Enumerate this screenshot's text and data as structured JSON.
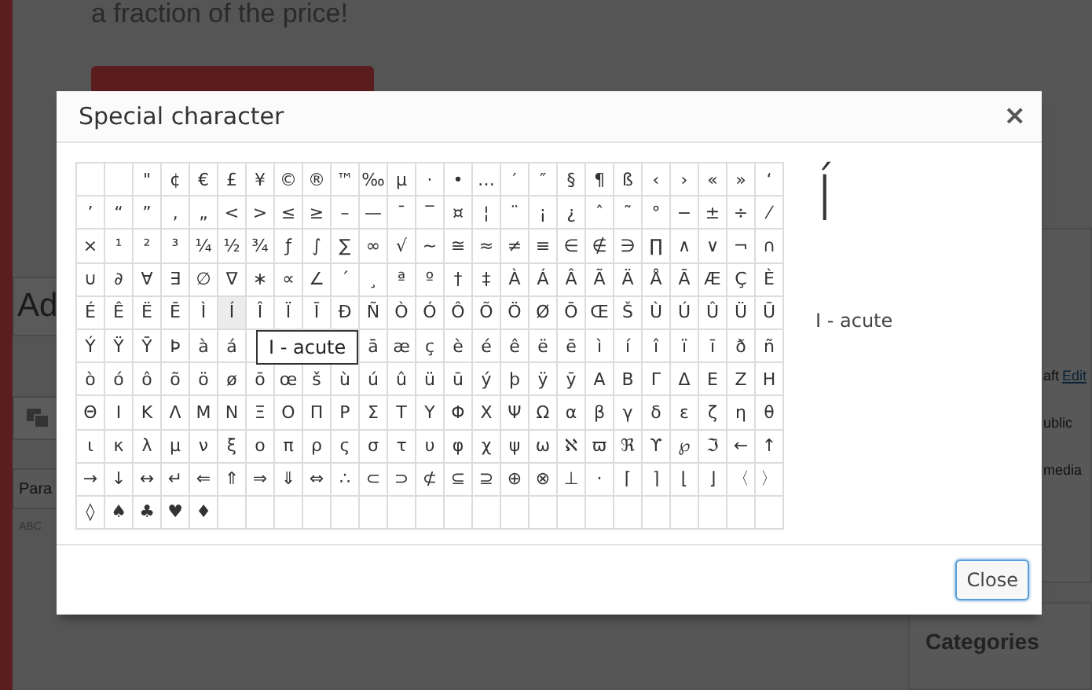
{
  "page": {
    "promo_text": "a fraction of the price!",
    "title_field": "Ad",
    "format_select": "Para",
    "spellcheck_label": "ABC",
    "sidebar": {
      "status_text": "aft",
      "status_link": "Edit",
      "visibility_text": "ublic",
      "media_text": "media",
      "categories_title": "Categories"
    }
  },
  "dialog": {
    "title": "Special character",
    "close_symbol": "×",
    "rows": [
      [
        {
          "hovered": false
        },
        {
          "hovered": false
        },
        {
          "c": "\"",
          "hovered": false
        },
        {
          "c": "¢",
          "hovered": false
        },
        {
          "c": "€",
          "hovered": false
        },
        {
          "c": "£",
          "hovered": false
        },
        {
          "c": "¥",
          "hovered": false
        },
        {
          "c": "©",
          "hovered": false
        },
        {
          "c": "®",
          "hovered": false
        },
        {
          "c": "™",
          "hovered": false
        },
        {
          "c": "‰",
          "hovered": false
        },
        {
          "c": "µ",
          "hovered": false
        },
        {
          "c": "·",
          "hovered": false
        },
        {
          "c": "•",
          "hovered": false
        },
        {
          "c": "…",
          "hovered": false
        },
        {
          "c": "′",
          "hovered": false
        },
        {
          "c": "″",
          "hovered": false
        },
        {
          "c": "§",
          "hovered": false
        },
        {
          "c": "¶",
          "hovered": false
        },
        {
          "c": "ß",
          "hovered": false
        },
        {
          "c": "‹",
          "hovered": false
        },
        {
          "c": "›",
          "hovered": false
        },
        {
          "c": "«",
          "hovered": false
        },
        {
          "c": "»",
          "hovered": false
        },
        {
          "c": "‘",
          "hovered": false
        }
      ],
      [
        {
          "c": "’",
          "hovered": false
        },
        {
          "c": "“",
          "hovered": false
        },
        {
          "c": "”",
          "hovered": false
        },
        {
          "c": "‚",
          "hovered": false
        },
        {
          "c": "„",
          "hovered": false
        },
        {
          "c": "<",
          "hovered": false
        },
        {
          "c": ">",
          "hovered": false
        },
        {
          "c": "≤",
          "hovered": false
        },
        {
          "c": "≥",
          "hovered": false
        },
        {
          "c": "–",
          "hovered": false
        },
        {
          "c": "—",
          "hovered": false
        },
        {
          "c": "¯",
          "hovered": false
        },
        {
          "c": "‾",
          "hovered": false
        },
        {
          "c": "¤",
          "hovered": false
        },
        {
          "c": "¦",
          "hovered": false
        },
        {
          "c": "¨",
          "hovered": false
        },
        {
          "c": "¡",
          "hovered": false
        },
        {
          "c": "¿",
          "hovered": false
        },
        {
          "c": "ˆ",
          "hovered": false
        },
        {
          "c": "˜",
          "hovered": false
        },
        {
          "c": "°",
          "hovered": false
        },
        {
          "c": "−",
          "hovered": false
        },
        {
          "c": "±",
          "hovered": false
        },
        {
          "c": "÷",
          "hovered": false
        },
        {
          "c": "⁄",
          "hovered": false
        }
      ],
      [
        {
          "c": "×",
          "hovered": false
        },
        {
          "c": "¹",
          "hovered": false
        },
        {
          "c": "²",
          "hovered": false
        },
        {
          "c": "³",
          "hovered": false
        },
        {
          "c": "¼",
          "hovered": false
        },
        {
          "c": "½",
          "hovered": false
        },
        {
          "c": "¾",
          "hovered": false
        },
        {
          "c": "ƒ",
          "hovered": false
        },
        {
          "c": "∫",
          "hovered": false
        },
        {
          "c": "∑",
          "hovered": false
        },
        {
          "c": "∞",
          "hovered": false
        },
        {
          "c": "√",
          "hovered": false
        },
        {
          "c": "∼",
          "hovered": false
        },
        {
          "c": "≅",
          "hovered": false
        },
        {
          "c": "≈",
          "hovered": false
        },
        {
          "c": "≠",
          "hovered": false
        },
        {
          "c": "≡",
          "hovered": false
        },
        {
          "c": "∈",
          "hovered": false
        },
        {
          "c": "∉",
          "hovered": false
        },
        {
          "c": "∋",
          "hovered": false
        },
        {
          "c": "∏",
          "hovered": false
        },
        {
          "c": "∧",
          "hovered": false
        },
        {
          "c": "∨",
          "hovered": false
        },
        {
          "c": "¬",
          "hovered": false
        },
        {
          "c": "∩",
          "hovered": false
        }
      ],
      [
        {
          "c": "∪",
          "hovered": false
        },
        {
          "c": "∂",
          "hovered": false
        },
        {
          "c": "∀",
          "hovered": false
        },
        {
          "c": "∃",
          "hovered": false
        },
        {
          "c": "∅",
          "hovered": false
        },
        {
          "c": "∇",
          "hovered": false
        },
        {
          "c": "∗",
          "hovered": false
        },
        {
          "c": "∝",
          "hovered": false
        },
        {
          "c": "∠",
          "hovered": false
        },
        {
          "c": "´",
          "hovered": false
        },
        {
          "c": "¸",
          "hovered": false
        },
        {
          "c": "ª",
          "hovered": false
        },
        {
          "c": "º",
          "hovered": false
        },
        {
          "c": "†",
          "hovered": false
        },
        {
          "c": "‡",
          "hovered": false
        },
        {
          "c": "À",
          "hovered": false
        },
        {
          "c": "Á",
          "hovered": false
        },
        {
          "c": "Â",
          "hovered": false
        },
        {
          "c": "Ã",
          "hovered": false
        },
        {
          "c": "Ä",
          "hovered": false
        },
        {
          "c": "Å",
          "hovered": false
        },
        {
          "c": "Ā",
          "hovered": false
        },
        {
          "c": "Æ",
          "hovered": false
        },
        {
          "c": "Ç",
          "hovered": false
        },
        {
          "c": "È",
          "hovered": false
        }
      ],
      [
        {
          "c": "É",
          "hovered": false
        },
        {
          "c": "Ê",
          "hovered": false
        },
        {
          "c": "Ë",
          "hovered": false
        },
        {
          "c": "Ē",
          "hovered": false
        },
        {
          "c": "Ì",
          "hovered": false
        },
        {
          "c": "Í",
          "hovered": true
        },
        {
          "c": "Î",
          "hovered": false
        },
        {
          "c": "Ï",
          "hovered": false
        },
        {
          "c": "Ī",
          "hovered": false
        },
        {
          "c": "Ð",
          "hovered": false
        },
        {
          "c": "Ñ",
          "hovered": false
        },
        {
          "c": "Ò",
          "hovered": false
        },
        {
          "c": "Ó",
          "hovered": false
        },
        {
          "c": "Ô",
          "hovered": false
        },
        {
          "c": "Õ",
          "hovered": false
        },
        {
          "c": "Ö",
          "hovered": false
        },
        {
          "c": "Ø",
          "hovered": false
        },
        {
          "c": "Ō",
          "hovered": false
        },
        {
          "c": "Œ",
          "hovered": false
        },
        {
          "c": "Š",
          "hovered": false
        },
        {
          "c": "Ù",
          "hovered": false
        },
        {
          "c": "Ú",
          "hovered": false
        },
        {
          "c": "Û",
          "hovered": false
        },
        {
          "c": "Ü",
          "hovered": false
        },
        {
          "c": "Ū",
          "hovered": false
        }
      ],
      [
        {
          "c": "Ý",
          "hovered": false
        },
        {
          "c": "Ÿ",
          "hovered": false
        },
        {
          "c": "Ȳ",
          "hovered": false
        },
        {
          "c": "Þ",
          "hovered": false
        },
        {
          "c": "à",
          "hovered": false
        },
        {
          "c": "á",
          "hovered": false
        },
        null,
        null,
        null,
        null,
        {
          "c": "ā",
          "hovered": false
        },
        {
          "c": "æ",
          "hovered": false
        },
        {
          "c": "ç",
          "hovered": false
        },
        {
          "c": "è",
          "hovered": false
        },
        {
          "c": "é",
          "hovered": false
        },
        {
          "c": "ê",
          "hovered": false
        },
        {
          "c": "ë",
          "hovered": false
        },
        {
          "c": "ē",
          "hovered": false
        },
        {
          "c": "ì",
          "hovered": false
        },
        {
          "c": "í",
          "hovered": false
        },
        {
          "c": "î",
          "hovered": false
        },
        {
          "c": "ï",
          "hovered": false
        },
        {
          "c": "ī",
          "hovered": false
        },
        {
          "c": "ð",
          "hovered": false
        },
        {
          "c": "ñ",
          "hovered": false
        }
      ],
      [
        {
          "c": "ò",
          "hovered": false
        },
        {
          "c": "ó",
          "hovered": false
        },
        {
          "c": "ô",
          "hovered": false
        },
        {
          "c": "õ",
          "hovered": false
        },
        {
          "c": "ö",
          "hovered": false
        },
        {
          "c": "ø",
          "hovered": false
        },
        {
          "c": "ō",
          "hovered": false
        },
        {
          "c": "œ",
          "hovered": false
        },
        {
          "c": "š",
          "hovered": false
        },
        {
          "c": "ù",
          "hovered": false
        },
        {
          "c": "ú",
          "hovered": false
        },
        {
          "c": "û",
          "hovered": false
        },
        {
          "c": "ü",
          "hovered": false
        },
        {
          "c": "ū",
          "hovered": false
        },
        {
          "c": "ý",
          "hovered": false
        },
        {
          "c": "þ",
          "hovered": false
        },
        {
          "c": "ÿ",
          "hovered": false
        },
        {
          "c": "ȳ",
          "hovered": false
        },
        {
          "c": "Α",
          "hovered": false
        },
        {
          "c": "Β",
          "hovered": false
        },
        {
          "c": "Γ",
          "hovered": false
        },
        {
          "c": "Δ",
          "hovered": false
        },
        {
          "c": "Ε",
          "hovered": false
        },
        {
          "c": "Ζ",
          "hovered": false
        },
        {
          "c": "Η",
          "hovered": false
        }
      ],
      [
        {
          "c": "Θ",
          "hovered": false
        },
        {
          "c": "Ι",
          "hovered": false
        },
        {
          "c": "Κ",
          "hovered": false
        },
        {
          "c": "Λ",
          "hovered": false
        },
        {
          "c": "Μ",
          "hovered": false
        },
        {
          "c": "Ν",
          "hovered": false
        },
        {
          "c": "Ξ",
          "hovered": false
        },
        {
          "c": "Ο",
          "hovered": false
        },
        {
          "c": "Π",
          "hovered": false
        },
        {
          "c": "Ρ",
          "hovered": false
        },
        {
          "c": "Σ",
          "hovered": false
        },
        {
          "c": "Τ",
          "hovered": false
        },
        {
          "c": "Υ",
          "hovered": false
        },
        {
          "c": "Φ",
          "hovered": false
        },
        {
          "c": "Χ",
          "hovered": false
        },
        {
          "c": "Ψ",
          "hovered": false
        },
        {
          "c": "Ω",
          "hovered": false
        },
        {
          "c": "α",
          "hovered": false
        },
        {
          "c": "β",
          "hovered": false
        },
        {
          "c": "γ",
          "hovered": false
        },
        {
          "c": "δ",
          "hovered": false
        },
        {
          "c": "ε",
          "hovered": false
        },
        {
          "c": "ζ",
          "hovered": false
        },
        {
          "c": "η",
          "hovered": false
        },
        {
          "c": "θ",
          "hovered": false
        }
      ],
      [
        {
          "c": "ι",
          "hovered": false
        },
        {
          "c": "κ",
          "hovered": false
        },
        {
          "c": "λ",
          "hovered": false
        },
        {
          "c": "μ",
          "hovered": false
        },
        {
          "c": "ν",
          "hovered": false
        },
        {
          "c": "ξ",
          "hovered": false
        },
        {
          "c": "ο",
          "hovered": false
        },
        {
          "c": "π",
          "hovered": false
        },
        {
          "c": "ρ",
          "hovered": false
        },
        {
          "c": "ς",
          "hovered": false
        },
        {
          "c": "σ",
          "hovered": false
        },
        {
          "c": "τ",
          "hovered": false
        },
        {
          "c": "υ",
          "hovered": false
        },
        {
          "c": "φ",
          "hovered": false
        },
        {
          "c": "χ",
          "hovered": false
        },
        {
          "c": "ψ",
          "hovered": false
        },
        {
          "c": "ω",
          "hovered": false
        },
        {
          "c": "ℵ",
          "hovered": false
        },
        {
          "c": "ϖ",
          "hovered": false
        },
        {
          "c": "ℜ",
          "hovered": false
        },
        {
          "c": "ϒ",
          "hovered": false
        },
        {
          "c": "℘",
          "hovered": false
        },
        {
          "c": "ℑ",
          "hovered": false
        },
        {
          "c": "←",
          "hovered": false
        },
        {
          "c": "↑",
          "hovered": false
        }
      ],
      [
        {
          "c": "→",
          "hovered": false
        },
        {
          "c": "↓",
          "hovered": false
        },
        {
          "c": "↔",
          "hovered": false
        },
        {
          "c": "↵",
          "hovered": false
        },
        {
          "c": "⇐",
          "hovered": false
        },
        {
          "c": "⇑",
          "hovered": false
        },
        {
          "c": "⇒",
          "hovered": false
        },
        {
          "c": "⇓",
          "hovered": false
        },
        {
          "c": "⇔",
          "hovered": false
        },
        {
          "c": "∴",
          "hovered": false
        },
        {
          "c": "⊂",
          "hovered": false
        },
        {
          "c": "⊃",
          "hovered": false
        },
        {
          "c": "⊄",
          "hovered": false
        },
        {
          "c": "⊆",
          "hovered": false
        },
        {
          "c": "⊇",
          "hovered": false
        },
        {
          "c": "⊕",
          "hovered": false
        },
        {
          "c": "⊗",
          "hovered": false
        },
        {
          "c": "⊥",
          "hovered": false
        },
        {
          "c": "⋅",
          "hovered": false
        },
        {
          "c": "⌈",
          "hovered": false
        },
        {
          "c": "⌉",
          "hovered": false
        },
        {
          "c": "⌊",
          "hovered": false
        },
        {
          "c": "⌋",
          "hovered": false
        },
        {
          "c": "〈",
          "hovered": false
        },
        {
          "c": "〉",
          "hovered": false
        }
      ],
      [
        {
          "c": "◊",
          "hovered": false
        },
        {
          "c": "♠",
          "hovered": false
        },
        {
          "c": "♣",
          "hovered": false
        },
        {
          "c": "♥",
          "hovered": false
        },
        {
          "c": "♦",
          "hovered": false
        },
        {
          "hovered": false
        },
        {
          "hovered": false
        },
        {
          "hovered": false
        },
        {
          "hovered": false
        },
        {
          "hovered": false
        },
        {
          "hovered": false
        },
        {
          "hovered": false
        },
        {
          "hovered": false
        },
        {
          "hovered": false
        },
        {
          "hovered": false
        },
        {
          "hovered": false
        },
        {
          "hovered": false
        },
        {
          "hovered": false
        },
        {
          "hovered": false
        },
        {
          "hovered": false
        },
        {
          "hovered": false
        },
        {
          "hovered": false
        },
        {
          "hovered": false
        },
        {
          "hovered": false
        },
        {
          "hovered": false
        }
      ]
    ],
    "tooltip": "I - acute",
    "preview_char": "Í",
    "preview_name": "I - acute",
    "close_button": "Close"
  }
}
